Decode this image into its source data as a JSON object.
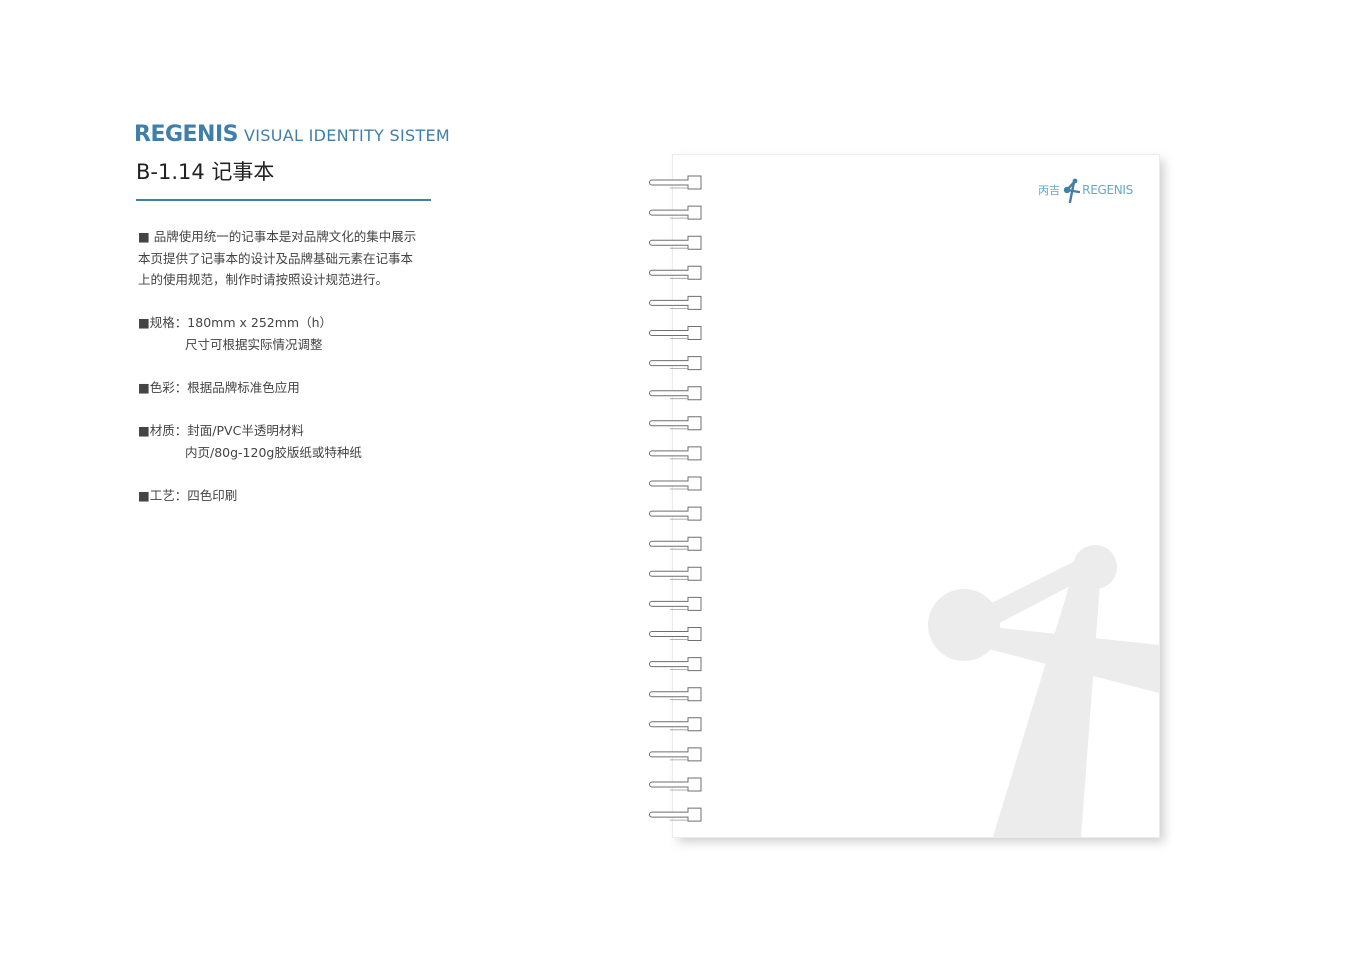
{
  "header": {
    "brand": "REGENIS",
    "subtitle": "VISUAL  IDENTITY  SISTEM",
    "title": "B-1.14 记事本"
  },
  "description": [
    "■ 品牌使用统一的记事本是对品牌文化的集中展示",
    "本页提供了记事本的设计及品牌基础元素在记事本",
    "上的使用规范，制作时请按照设计规范进行。"
  ],
  "specs": {
    "size": {
      "line1": "■规格：180mm x 252mm（h）",
      "line2": "尺寸可根据实际情况调整"
    },
    "color": {
      "line1": "■色彩：根据品牌标准色应用"
    },
    "material": {
      "line1": "■材质：封面/PVC半透明材料",
      "line2": "内页/80g-120g胶版纸或特种纸"
    },
    "craft": {
      "line1": "■工艺：四色印刷"
    }
  },
  "notebook": {
    "logo_cn": "丙吉",
    "logo_en": "REGENIS",
    "ring_count": 22,
    "accent_color": "#3f7fa9",
    "watermark_color": "#ececec"
  }
}
